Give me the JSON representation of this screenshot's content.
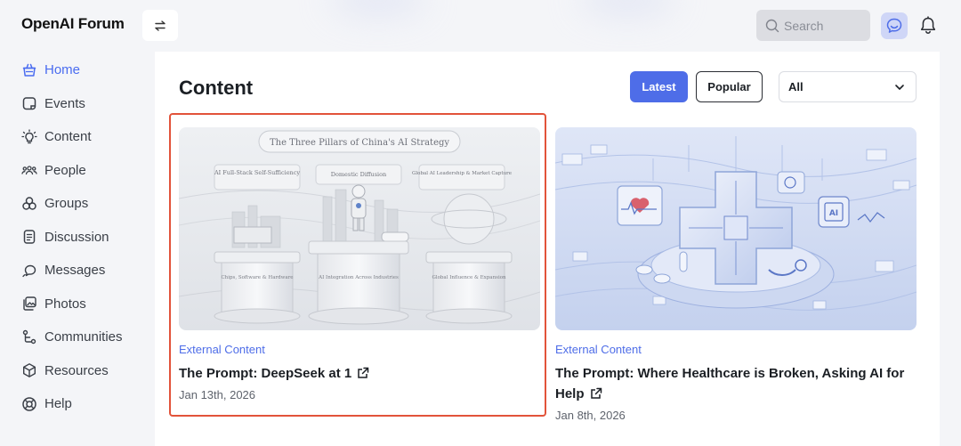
{
  "header": {
    "logo": "OpenAI  Forum",
    "search_placeholder": "Search"
  },
  "sidebar": {
    "items": [
      {
        "label": "Home",
        "icon": "basket-icon",
        "active": true
      },
      {
        "label": "Events",
        "icon": "calendar-icon",
        "active": false
      },
      {
        "label": "Content",
        "icon": "lightbulb-icon",
        "active": false
      },
      {
        "label": "People",
        "icon": "people-icon",
        "active": false
      },
      {
        "label": "Groups",
        "icon": "groups-icon",
        "active": false
      },
      {
        "label": "Discussion",
        "icon": "discussion-icon",
        "active": false
      },
      {
        "label": "Messages",
        "icon": "messages-icon",
        "active": false
      },
      {
        "label": "Photos",
        "icon": "photos-icon",
        "active": false
      },
      {
        "label": "Communities",
        "icon": "communities-icon",
        "active": false
      },
      {
        "label": "Resources",
        "icon": "cube-icon",
        "active": false
      },
      {
        "label": "Help",
        "icon": "lifebuoy-icon",
        "active": false
      }
    ]
  },
  "main": {
    "title": "Content",
    "filters": {
      "latest": "Latest",
      "popular": "Popular",
      "category_selected": "All"
    },
    "cards": [
      {
        "category": "External Content",
        "title": "The Prompt: DeepSeek at 1",
        "date": "Jan 13th, 2026",
        "thumb": {
          "banner": "The Three Pillars of China's AI Strategy",
          "pillars": [
            "AI Full-Stack Self-Sufficiency",
            "Domestic Diffusion",
            "Global AI Leadership & Market Capture"
          ],
          "bases": [
            "Chips, Software & Hardware",
            "AI Integration Across Industries",
            "Global Influence & Expansion"
          ]
        }
      },
      {
        "category": "External Content",
        "title": "The Prompt: Where Healthcare is Broken, Asking AI for Help",
        "date": "Jan 8th, 2026",
        "thumb": {
          "chip_label": "AI"
        }
      }
    ]
  },
  "colors": {
    "accent": "#4e6de8",
    "highlight": "#e2533a"
  }
}
